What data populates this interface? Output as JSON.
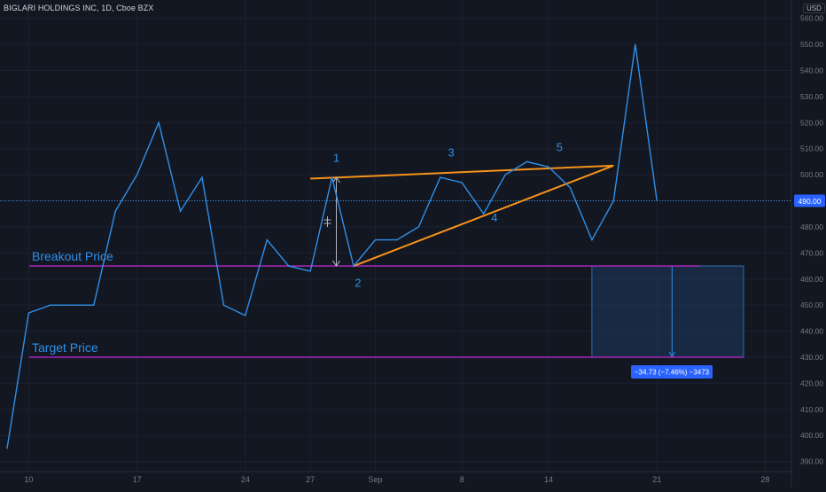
{
  "header": {
    "symbol_title": "BIGLARI HOLDINGS INC, 1D, Cboe BZX",
    "currency": "USD"
  },
  "colors": {
    "background": "#131722",
    "grid": "#1c2030",
    "price_line": "#2f8fe8",
    "wedge": "#f7931a",
    "level_line": "#9c27b0",
    "label_text": "#2f8fe8",
    "axis_text": "#787b86",
    "badge_bg": "#2962ff",
    "measure_box": "#1e3a5f"
  },
  "annotations": {
    "breakout_label": "Breakout Price",
    "target_label": "Target Price",
    "points": [
      "1",
      "2",
      "3",
      "4",
      "5"
    ],
    "measure_label": "−34.73 (−7.46%) −3473",
    "current_price": "490.00"
  },
  "chart_data": {
    "type": "line",
    "x": [
      0,
      1,
      2,
      3,
      4,
      5,
      6,
      7,
      8,
      9,
      10,
      11,
      12,
      13,
      14,
      15,
      16,
      17,
      18,
      19,
      20,
      21,
      22,
      23,
      24,
      25,
      26,
      27,
      28,
      29,
      30
    ],
    "values": [
      395,
      447,
      450,
      450,
      450,
      486,
      500,
      520,
      486,
      499,
      450,
      446,
      475,
      465,
      463,
      499,
      465,
      475,
      475,
      480,
      499,
      497,
      485,
      500,
      505,
      503,
      495,
      475,
      490,
      550,
      490
    ],
    "ylim": [
      380,
      565
    ],
    "y_ticks": [
      390,
      400,
      410,
      420,
      430,
      440,
      450,
      460,
      470,
      480,
      490,
      500,
      510,
      520,
      530,
      540,
      550,
      560
    ],
    "y_tick_labels": [
      "390.00",
      "400.00",
      "410.00",
      "420.00",
      "430.00",
      "440.00",
      "450.00",
      "460.00",
      "470.00",
      "480.00",
      "490.00",
      "500.00",
      "510.00",
      "520.00",
      "530.00",
      "540.00",
      "550.00",
      "560.00"
    ],
    "x_ticks": [
      {
        "pos": 1,
        "label": "10"
      },
      {
        "pos": 6,
        "label": "17"
      },
      {
        "pos": 11,
        "label": "24"
      },
      {
        "pos": 14,
        "label": "27"
      },
      {
        "pos": 17,
        "label": "Sep"
      },
      {
        "pos": 21,
        "label": "8"
      },
      {
        "pos": 25,
        "label": "14"
      },
      {
        "pos": 30,
        "label": "21"
      },
      {
        "pos": 35,
        "label": "28"
      }
    ],
    "breakout_price": 465,
    "target_price": 430,
    "current_price": 490,
    "wedge_upper": [
      [
        14,
        498.5
      ],
      [
        28,
        503.5
      ]
    ],
    "wedge_lower": [
      [
        16,
        465
      ],
      [
        28,
        503.5
      ]
    ],
    "pattern_point_labels": [
      {
        "label": "1",
        "x": 15.2,
        "y": 505
      },
      {
        "label": "2",
        "x": 16.2,
        "y": 457
      },
      {
        "label": "3",
        "x": 20.5,
        "y": 507
      },
      {
        "label": "4",
        "x": 22.5,
        "y": 482
      },
      {
        "label": "5",
        "x": 25.5,
        "y": 509
      }
    ],
    "height_arrow": {
      "x": 15.2,
      "from": 499,
      "to": 465
    },
    "measure_zone": {
      "x_from": 27,
      "x_to": 34,
      "top": 465,
      "bottom": 430,
      "arrow_x": 30.7
    }
  }
}
